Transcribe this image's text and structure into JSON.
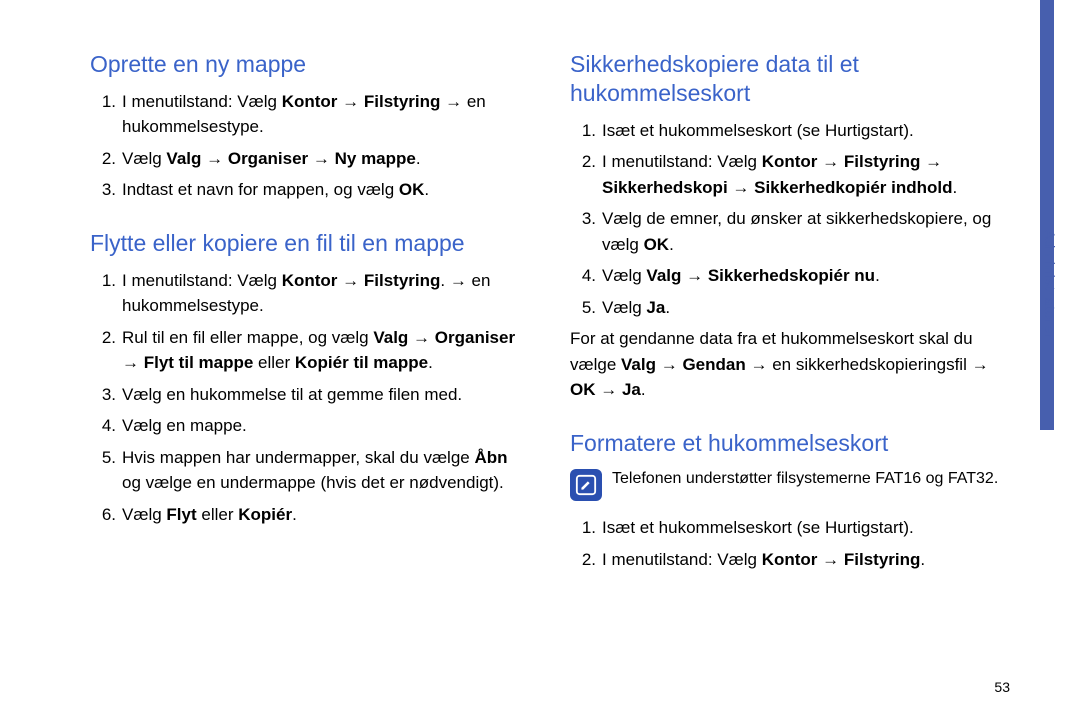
{
  "side_label": "Administratorer",
  "page_number": "53",
  "arrow": "→",
  "left": {
    "sec1": {
      "title": "Oprette en ny mappe",
      "items": [
        {
          "n": "1.",
          "parts": [
            "I menutilstand: Vælg ",
            "Kontor",
            " → ",
            "Filstyring",
            " → en hukommelsestype."
          ]
        },
        {
          "n": "2.",
          "parts": [
            "Vælg ",
            "Valg",
            " → ",
            "Organiser",
            " → ",
            "Ny mappe",
            "."
          ]
        },
        {
          "n": "3.",
          "parts": [
            "Indtast et navn for mappen, og vælg ",
            "OK",
            "."
          ]
        }
      ]
    },
    "sec2": {
      "title": "Flytte eller kopiere en fil til en mappe",
      "items": [
        {
          "n": "1.",
          "parts": [
            "I menutilstand: Vælg ",
            "Kontor",
            " → ",
            "Filstyring",
            ". → en hukommelsestype."
          ]
        },
        {
          "n": "2.",
          "parts": [
            "Rul til en fil eller mappe, og vælg ",
            "Valg",
            " → ",
            "Organiser",
            " → ",
            "Flyt til mappe",
            " eller ",
            "Kopiér til mappe",
            "."
          ]
        },
        {
          "n": "3.",
          "parts": [
            "Vælg en hukommelse til at gemme filen med."
          ]
        },
        {
          "n": "4.",
          "parts": [
            "Vælg en mappe."
          ]
        },
        {
          "n": "5.",
          "parts": [
            "Hvis mappen har undermapper, skal du vælge ",
            "Åbn",
            " og vælge en undermappe (hvis det er nødvendigt)."
          ]
        },
        {
          "n": "6.",
          "parts": [
            "Vælg ",
            "Flyt",
            " eller ",
            "Kopiér",
            "."
          ]
        }
      ]
    }
  },
  "right": {
    "sec1": {
      "title": "Sikkerhedskopiere data til et hukommelseskort",
      "items": [
        {
          "n": "1.",
          "parts": [
            "Isæt et hukommelseskort (se Hurtigstart)."
          ]
        },
        {
          "n": "2.",
          "parts": [
            "I menutilstand: Vælg ",
            "Kontor",
            " → ",
            "Filstyring",
            " → ",
            "Sikkerhedskopi",
            " → ",
            "Sikkerhedkopiér indhold",
            "."
          ]
        },
        {
          "n": "3.",
          "parts": [
            "Vælg de emner, du ønsker at sikkerhedskopiere, og vælg ",
            "OK",
            "."
          ]
        },
        {
          "n": "4.",
          "parts": [
            "Vælg ",
            "Valg",
            " → ",
            "Sikkerhedskopiér nu",
            "."
          ]
        },
        {
          "n": "5.",
          "parts": [
            "Vælg ",
            "Ja",
            "."
          ]
        }
      ],
      "after": [
        "For at gendanne data fra et hukommelseskort skal du vælge ",
        "Valg",
        " → ",
        "Gendan",
        " → en sikkerhedskopieringsfil → ",
        "OK",
        " → ",
        "Ja",
        "."
      ]
    },
    "sec2": {
      "title": "Formatere et hukommelseskort",
      "note": "Telefonen understøtter filsystemerne FAT16 og FAT32.",
      "items": [
        {
          "n": "1.",
          "parts": [
            "Isæt et hukommelseskort (se Hurtigstart)."
          ]
        },
        {
          "n": "2.",
          "parts": [
            "I menutilstand: Vælg ",
            "Kontor",
            " → ",
            "Filstyring",
            "."
          ]
        }
      ]
    }
  }
}
